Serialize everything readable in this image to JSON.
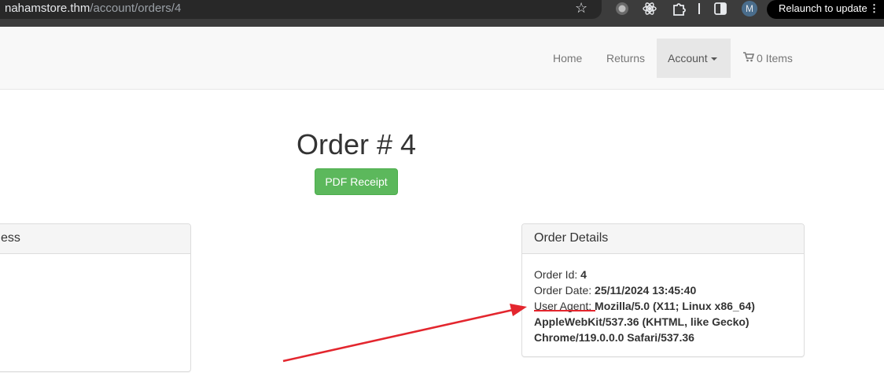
{
  "browser": {
    "url_host": "nahamstore.thm",
    "url_path": "/account/orders/4",
    "avatar_letter": "M",
    "relaunch_label": "Relaunch to update",
    "menu_glyph": "⋮",
    "icons": [
      "star-icon",
      "record-icon",
      "react-icon",
      "puzzle-icon",
      "sidebar-icon",
      "avatar"
    ]
  },
  "navbar": {
    "home": "Home",
    "returns": "Returns",
    "account": "Account",
    "cart": "0 Items"
  },
  "order": {
    "title": "Order # 4",
    "pdf_button": "PDF Receipt"
  },
  "address_panel": {
    "heading": "ess"
  },
  "order_details": {
    "heading": "Order Details",
    "id_label": "Order Id:",
    "id_value": "4",
    "date_label": "Order Date:",
    "date_value": "25/11/2024 13:45:40",
    "ua_label": "User Agent:",
    "ua_line1": "Mozilla/5.0 (X11; Linux x86_64)",
    "ua_line2": "AppleWebKit/537.36 (KHTML, like Gecko)",
    "ua_line3": "Chrome/119.0.0.0 Safari/537.36"
  },
  "colors": {
    "success_button": "#5cb85c",
    "annotation_red": "#e3262e",
    "navbar_bg": "#f8f8f8",
    "chrome_bg": "#3c3c3c"
  }
}
